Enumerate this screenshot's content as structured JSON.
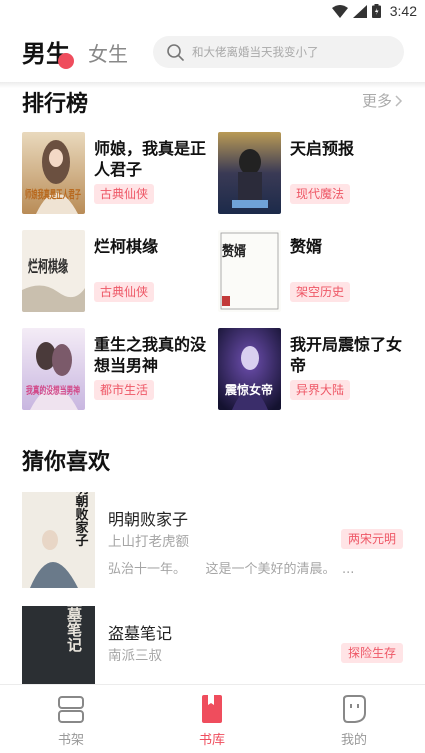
{
  "status_bar": {
    "time": "3:42"
  },
  "header": {
    "tab_male": "男生",
    "tab_female": "女生",
    "search_placeholder": "和大佬离婚当天我变小了"
  },
  "ranking": {
    "title": "排行榜",
    "more": "更多",
    "books": [
      {
        "name": "师娘，我真是正人君子",
        "tag": "古典仙侠",
        "cover_text": "师娘我真是正人君子"
      },
      {
        "name": "天启预报",
        "tag": "现代魔法",
        "cover_text": ""
      },
      {
        "name": "烂柯棋缘",
        "tag": "古典仙侠",
        "cover_text": "烂柯棋缘"
      },
      {
        "name": "赘婿",
        "tag": "架空历史",
        "cover_text": "赘婿"
      },
      {
        "name": "重生之我真的没想当男神",
        "tag": "都市生活",
        "cover_text": "我真的没想当男神"
      },
      {
        "name": "我开局震惊了女帝",
        "tag": "异界大陆",
        "cover_text": "震惊女帝"
      }
    ]
  },
  "guess": {
    "title": "猜你喜欢",
    "books": [
      {
        "name": "明朝败家子",
        "author": "上山打老虎额",
        "tag": "两宋元明",
        "desc": "弘治十一年。　　这是一个美好的清晨。　...",
        "cover_text": "明朝败家子"
      },
      {
        "name": "盗墓笔记",
        "author": "南派三叔",
        "tag": "探险生存",
        "desc": "",
        "cover_text": "盗墓笔记"
      }
    ]
  },
  "bottom_nav": {
    "items": [
      {
        "label": "书架",
        "icon": "bookshelf-icon"
      },
      {
        "label": "书库",
        "icon": "bookstore-icon",
        "active": true
      },
      {
        "label": "我的",
        "icon": "profile-icon"
      }
    ]
  },
  "colors": {
    "accent": "#ef4d5d",
    "tag_bg": "#ffe4e6",
    "tag_text": "#ee5766"
  }
}
